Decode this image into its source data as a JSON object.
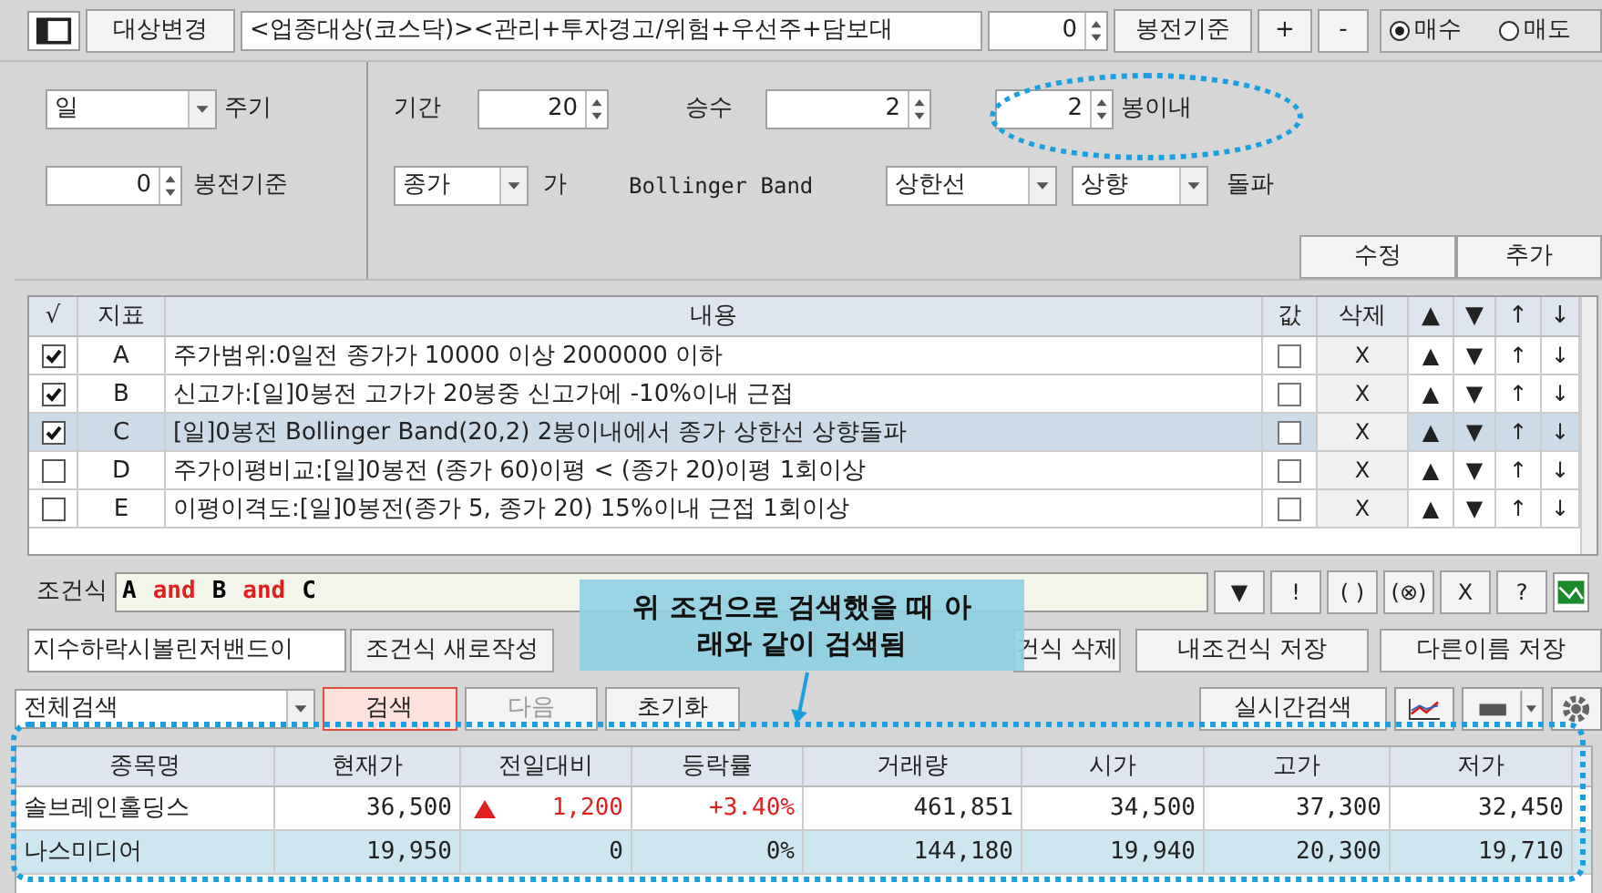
{
  "toolbar": {
    "target_button": "대상변경",
    "target_text": "<업종대상(코스닥)><관리+투자경고/위험+우선주+담보대",
    "offset_value": "0",
    "offset_button": "봉전기준",
    "plus_button": "+",
    "minus_button": "-",
    "trade_side": [
      {
        "label": "매수",
        "selected": true
      },
      {
        "label": "매도",
        "selected": false
      }
    ]
  },
  "params": {
    "period": {
      "value": "일",
      "label": "주기"
    },
    "offset": {
      "value": "0",
      "label": "봉전기준"
    },
    "term": {
      "label": "기간",
      "value": "20"
    },
    "multiplier": {
      "label": "승수",
      "value": "2"
    },
    "within": {
      "value": "2",
      "label": "봉이내"
    },
    "price": {
      "value": "종가",
      "suffix": "가"
    },
    "indicator": "Bollinger Band",
    "band": "상한선",
    "direction": "상향",
    "action": "돌파"
  },
  "edit_buttons": [
    "수정",
    "추가"
  ],
  "conditions": {
    "columns": [
      "√",
      "지표",
      "내용",
      "값",
      "삭제",
      "▲",
      "▼",
      "↑",
      "↓"
    ],
    "rows": [
      {
        "checked": true,
        "code": "A",
        "content": "주가범위:0일전 종가가 10000 이상 2000000 이하",
        "value_checked": false,
        "selected": false,
        "actions": [
          "X",
          "▲",
          "▼",
          "↑",
          "↓"
        ]
      },
      {
        "checked": true,
        "code": "B",
        "content": "신고가:[일]0봉전 고가가 20봉중 신고가에 -10%이내 근접",
        "value_checked": false,
        "selected": false,
        "actions": [
          "X",
          "▲",
          "▼",
          "↑",
          "↓"
        ]
      },
      {
        "checked": true,
        "code": "C",
        "content": "[일]0봉전 Bollinger Band(20,2) 2봉이내에서 종가 상한선 상향돌파",
        "value_checked": false,
        "selected": true,
        "actions": [
          "X",
          "▲",
          "▼",
          "↑",
          "↓"
        ]
      },
      {
        "checked": false,
        "code": "D",
        "content": "주가이평비교:[일]0봉전 (종가 60)이평 < (종가 20)이평 1회이상",
        "value_checked": false,
        "selected": false,
        "actions": [
          "X",
          "▲",
          "▼",
          "↑",
          "↓"
        ]
      },
      {
        "checked": false,
        "code": "E",
        "content": "이평이격도:[일]0봉전(종가 5, 종가 20) 15%이내 근접 1회이상",
        "value_checked": false,
        "selected": false,
        "actions": [
          "X",
          "▲",
          "▼",
          "↑",
          "↓"
        ]
      }
    ]
  },
  "formula": {
    "label": "조건식",
    "tokens": [
      {
        "text": "A",
        "kind": "operand"
      },
      {
        "text": "and",
        "kind": "operator"
      },
      {
        "text": "B",
        "kind": "operand"
      },
      {
        "text": "and",
        "kind": "operator"
      },
      {
        "text": "C",
        "kind": "operand"
      }
    ],
    "buttons": [
      "▼",
      "!",
      "( )",
      "(⊗)",
      "X",
      "?"
    ]
  },
  "name_field": "지수하락시볼린저밴드이",
  "action_buttons": [
    {
      "label": "조건식 새로작성",
      "kind": "left"
    },
    {
      "label": "건식 삭제",
      "kind": "left"
    },
    {
      "label": "내조건식 저장",
      "kind": "right"
    },
    {
      "label": "다른이름 저장",
      "kind": "right"
    }
  ],
  "search": {
    "scope": "전체검색",
    "buttons": [
      {
        "label": "검색",
        "kind": "primary",
        "disabled": false
      },
      {
        "label": "다음",
        "kind": "normal",
        "disabled": true
      },
      {
        "label": "초기화",
        "kind": "normal",
        "disabled": false
      }
    ],
    "realtime_button": "실시간검색"
  },
  "callout": {
    "lines": [
      "위 조건으로 검색했을 때 아",
      "래와 같이 검색됨"
    ]
  },
  "results": {
    "columns": [
      "종목명",
      "현재가",
      "전일대비",
      "등락률",
      "거래량",
      "시가",
      "고가",
      "저가"
    ],
    "rows": [
      {
        "name": "솔브레인홀딩스",
        "price": "36,500",
        "kind": "rise",
        "change": "1,200",
        "rate": "+3.40%",
        "volume": "461,851",
        "open": "34,500",
        "high": "37,300",
        "low": "32,450",
        "selected": false
      },
      {
        "name": "나스미디어",
        "price": "19,950",
        "kind": "flat",
        "change": "0",
        "rate": "0%",
        "volume": "144,180",
        "open": "19,940",
        "high": "20,300",
        "low": "19,710",
        "selected": true
      }
    ]
  }
}
